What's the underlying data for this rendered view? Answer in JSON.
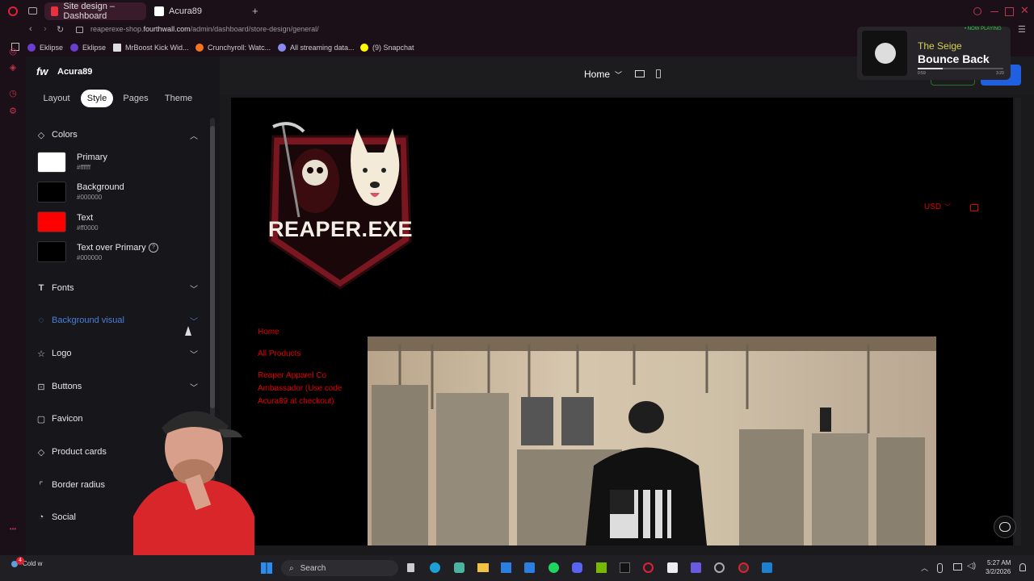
{
  "browser": {
    "tabs": [
      {
        "label": "Site design – Dashboard",
        "active": true
      },
      {
        "label": "Acura89",
        "active": false
      }
    ],
    "url_prefix": "reaperexe-shop.",
    "url_host": "fourthwall.com",
    "url_path": "/admin/dashboard/store-design/general/",
    "bookmarks": [
      "Eklipse",
      "Eklipse",
      "MrBoost Kick Wid...",
      "Crunchyroll: Watc...",
      "All streaming data...",
      "(9) Snapchat"
    ]
  },
  "media": {
    "badge": "• NOW PLAYING",
    "artist": "The Seige",
    "title": "Bounce Back",
    "elapsed": "0:59",
    "duration": "3:20"
  },
  "panel": {
    "brand": "fw",
    "store_name": "Acura89",
    "tabs": [
      "Layout",
      "Style",
      "Pages",
      "Theme"
    ],
    "sections": {
      "colors": "Colors",
      "fonts": "Fonts",
      "background_visual": "Background visual",
      "logo": "Logo",
      "buttons": "Buttons",
      "favicon": "Favicon",
      "product_cards": "Product cards",
      "border_radius": "Border radius",
      "social": "Social"
    },
    "colors": [
      {
        "label": "Primary",
        "hex": "#ffffff",
        "display": "#ffffff"
      },
      {
        "label": "Background",
        "hex": "#000000",
        "display": "#000000"
      },
      {
        "label": "Text",
        "hex": "#ff0000",
        "display": "#ff0000"
      },
      {
        "label": "Text over Primary",
        "hex": "#000000",
        "display": "#000000"
      }
    ]
  },
  "preview": {
    "page_select": "Home",
    "site": {
      "logo_text": "REAPER.EXE",
      "currency": "USD",
      "nav": [
        "Home",
        "All Products",
        "Reaper Apparel Co Ambassador (Use code Acura89 at checkout)"
      ]
    }
  },
  "taskbar": {
    "weather": "Cold w",
    "search": "Search",
    "time": "5:27 AM",
    "date": "3/2/2026",
    "notification_count": "4"
  },
  "colors": {
    "accent": "#4a7fd8",
    "site_text": "#e00000"
  }
}
